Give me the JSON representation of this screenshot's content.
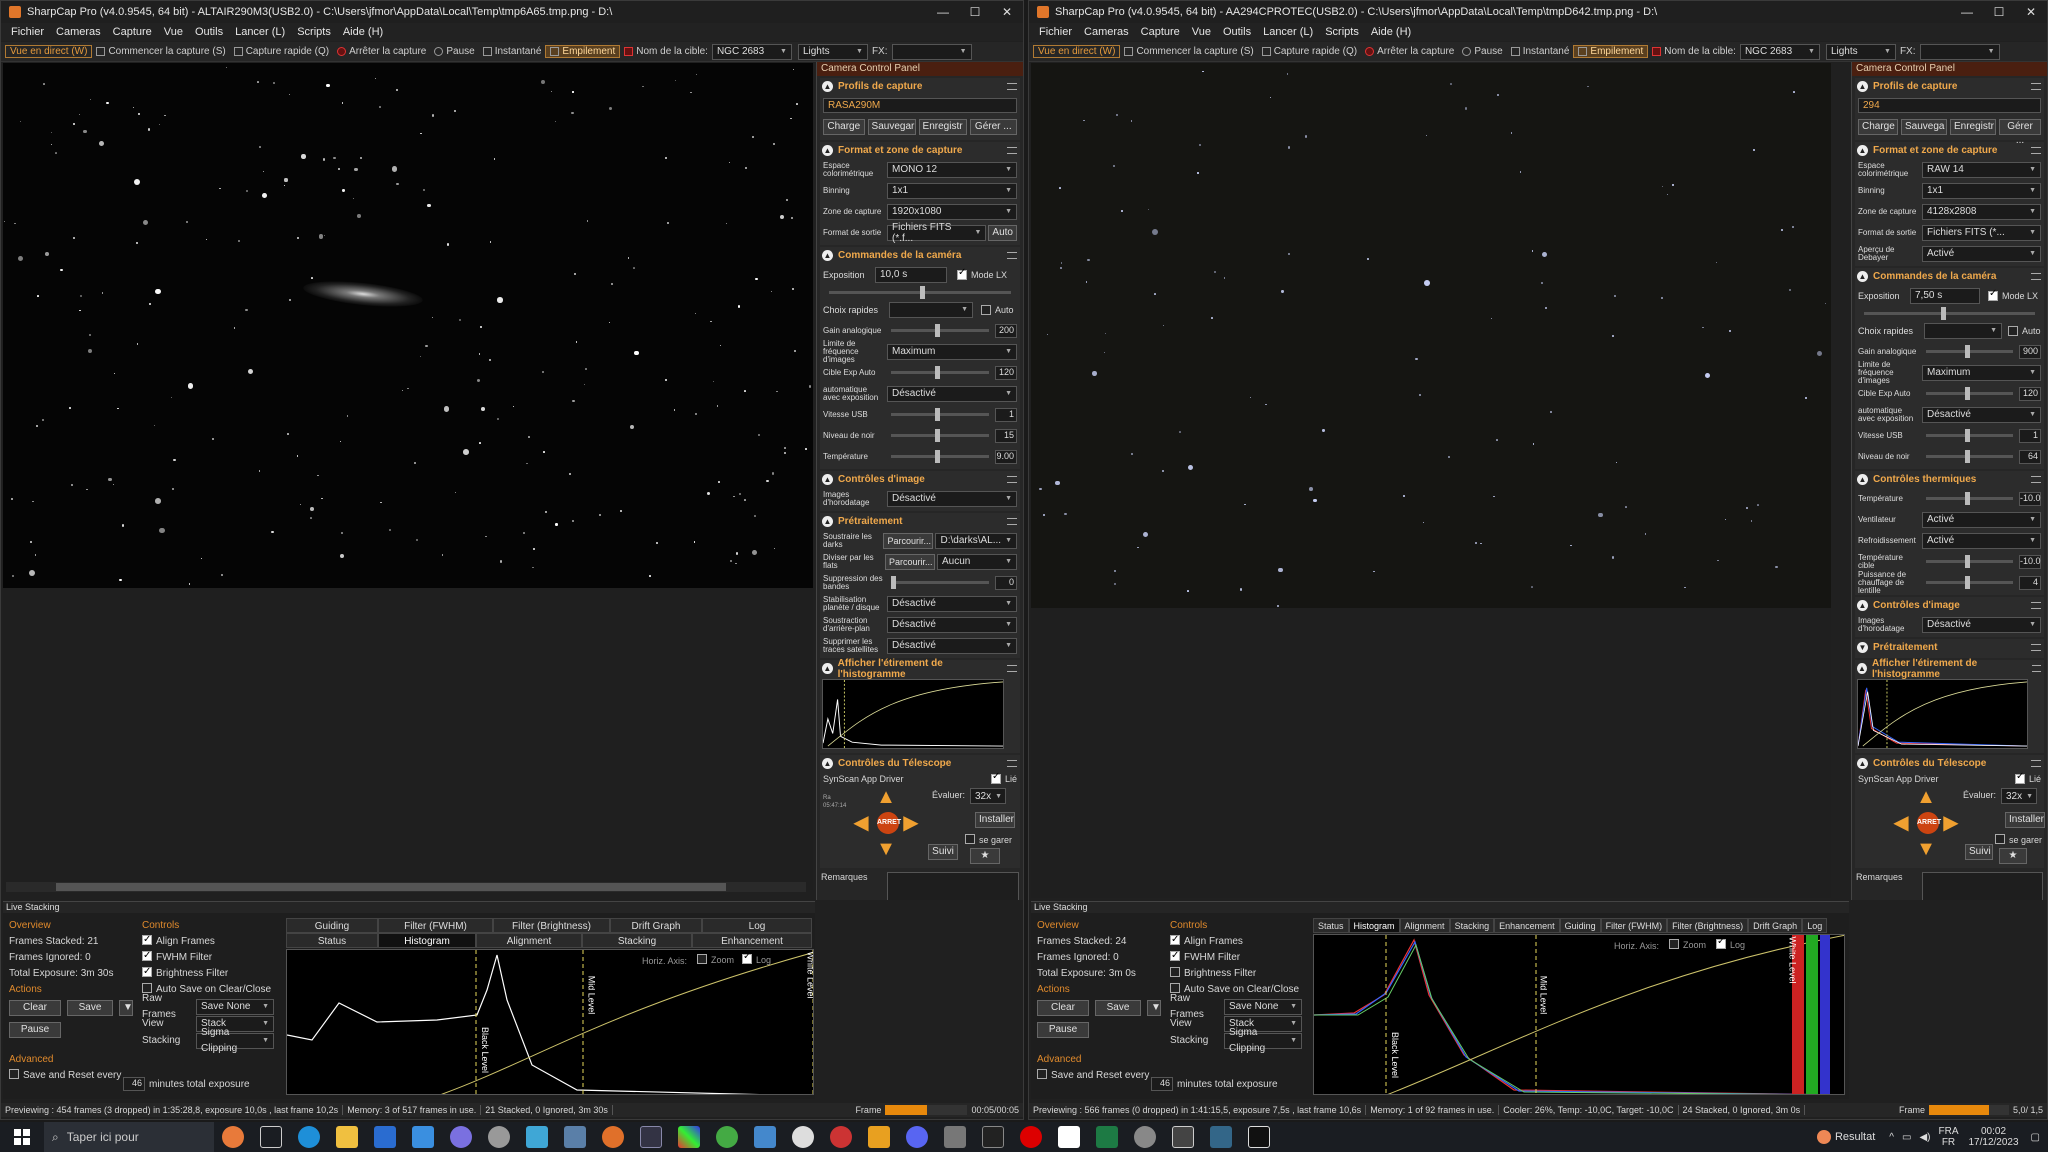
{
  "left": {
    "title": "SharpCap Pro (v4.0.9545, 64 bit) - ALTAIR290M3(USB2.0) - C:\\Users\\jfmor\\AppData\\Local\\Temp\\tmp6A65.tmp.png - D:\\",
    "menu": [
      "Fichier",
      "Cameras",
      "Capture",
      "Vue",
      "Outils",
      "Lancer (L)",
      "Scripts",
      "Aide (H)"
    ],
    "toolbar": {
      "live": "Vue en direct (W)",
      "start": "Commencer la capture (S)",
      "quick": "Capture rapide (Q)",
      "stop": "Arrêter la capture",
      "pause": "Pause",
      "snap": "Instantané",
      "stack": "Empilement",
      "target_label": "Nom de la cible:",
      "target": "NGC 2683",
      "frame_type": "Lights",
      "fx_label": "FX:"
    },
    "panel_title": "Camera Control Panel",
    "profiles": {
      "title": "Profils de capture",
      "value": "RASA290M",
      "buttons": [
        "Charge",
        "Sauvegar",
        "Enregistr",
        "Gérer ..."
      ]
    },
    "format": {
      "title": "Format et zone de capture",
      "rows": [
        {
          "label": "Espace colorimétrique",
          "value": "MONO 12"
        },
        {
          "label": "Binning",
          "value": "1x1"
        },
        {
          "label": "Zone de capture",
          "value": "1920x1080"
        },
        {
          "label": "Format de sortie",
          "value": "Fichiers FITS (*.f..."
        }
      ],
      "auto": "Auto"
    },
    "camera": {
      "title": "Commandes de la caméra",
      "exposure_label": "Exposition",
      "exposure": "10,0 s",
      "lx": "Mode LX",
      "quick_label": "Choix rapides",
      "auto": "Auto",
      "rows": [
        {
          "label": "Gain analogique",
          "value": "200",
          "kind": "slider"
        },
        {
          "label": "Limite de fréquence d'images",
          "value": "Maximum",
          "kind": "select"
        },
        {
          "label": "Cible Exp Auto",
          "value": "120",
          "kind": "slider"
        },
        {
          "label": "automatique avec exposition",
          "value": "Désactivé",
          "kind": "select"
        },
        {
          "label": "Vitesse USB",
          "value": "1",
          "kind": "slider"
        },
        {
          "label": "Niveau de noir",
          "value": "15",
          "kind": "slider"
        },
        {
          "label": "Température",
          "value": "9.00",
          "kind": "slider"
        }
      ]
    },
    "image_ctrl": {
      "title": "Contrôles d'image",
      "rows": [
        {
          "label": "Images d'horodatage",
          "value": "Désactivé"
        }
      ]
    },
    "preproc": {
      "title": "Prétraitement",
      "rows": [
        {
          "label": "Soustraire les darks",
          "browse": "Parcourir...",
          "value": "D:\\darks\\AL..."
        },
        {
          "label": "Diviser par les flats",
          "browse": "Parcourir...",
          "value": "Aucun"
        },
        {
          "label": "Suppression des bandes",
          "value": "0",
          "kind": "slider"
        },
        {
          "label": "Stabilisation planète / disque",
          "value": "Désactivé"
        },
        {
          "label": "Soustraction d'arrière-plan",
          "value": "Désactivé"
        },
        {
          "label": "Supprimer les traces satellites",
          "value": "Désactivé"
        }
      ]
    },
    "histo": {
      "title": "Afficher l'étirement de l'histogramme"
    },
    "telescope": {
      "title": "Contrôles du Télescope",
      "driver": "SynScan App Driver",
      "linked": "Lié",
      "eval_label": "Évaluer:",
      "eval": "32x",
      "install": "Installer",
      "park": "se garer",
      "suivi": "Suivi",
      "stop": "ARRET",
      "coords": "Ra 05:47:14"
    },
    "remarks": "Remarques",
    "livestack": {
      "title": "Live Stacking",
      "overview": "Overview",
      "stacked": "Frames Stacked: 21",
      "ignored": "Frames Ignored: 0",
      "exposure": "Total Exposure: 3m 30s",
      "actions": "Actions",
      "clear": "Clear",
      "save": "Save",
      "pause": "Pause",
      "advanced": "Advanced",
      "save_reset": "Save and Reset every",
      "minutes": "46",
      "minutes_label": "minutes total exposure",
      "controls": "Controls",
      "align": "Align Frames",
      "fwhm": "FWHM Filter",
      "bright": "Brightness Filter",
      "autosave": "Auto Save on Clear/Close",
      "raw_label": "Raw Frames",
      "raw": "Save None",
      "view_label": "View",
      "view": "Stack",
      "stacking_label": "Stacking",
      "stacking": "Sigma Clipping",
      "tabs_top": [
        "Guiding",
        "Filter (FWHM)",
        "Filter (Brightness)",
        "Drift Graph",
        "Log"
      ],
      "tabs_bottom": [
        "Status",
        "Histogram",
        "Alignment",
        "Stacking",
        "Enhancement"
      ],
      "horiz": "Horiz. Axis:",
      "zoom": "Zoom",
      "log": "Log",
      "black": "Black Level",
      "mid": "Mid Level",
      "white": "White Level"
    },
    "status": [
      "Previewing : 454 frames (3 dropped) in 1:35:28,8, exposure 10,0s , last frame 10,2s",
      "Memory: 3 of 517 frames in use.",
      "21 Stacked, 0 Ignored, 3m 30s"
    ],
    "frame_label": "Frame",
    "frame_time": "00:05/00:05"
  },
  "right": {
    "title": "SharpCap Pro (v4.0.9545, 64 bit) - AA294CPROTEC(USB2.0) - C:\\Users\\jfmor\\AppData\\Local\\Temp\\tmpD642.tmp.png - D:\\",
    "toolbar": {
      "target": "NGC 2683",
      "frame_type": "Lights"
    },
    "profiles": {
      "value": "294",
      "buttons": [
        "Charge",
        "Sauvega",
        "Enregistr",
        "Gérer ..."
      ]
    },
    "format": {
      "rows": [
        {
          "label": "Espace colorimétrique",
          "value": "RAW 14"
        },
        {
          "label": "Binning",
          "value": "1x1"
        },
        {
          "label": "Zone de capture",
          "value": "4128x2808"
        },
        {
          "label": "Format de sortie",
          "value": "Fichiers FITS (*..."
        },
        {
          "label": "Aperçu de Debayer",
          "value": "Activé"
        }
      ]
    },
    "camera": {
      "exposure": "7,50 s",
      "rows": [
        {
          "label": "Gain analogique",
          "value": "900",
          "kind": "slider"
        },
        {
          "label": "Limite de fréquence d'images",
          "value": "Maximum",
          "kind": "select"
        },
        {
          "label": "Cible Exp Auto",
          "value": "120",
          "kind": "slider"
        },
        {
          "label": "automatique avec exposition",
          "value": "Désactivé",
          "kind": "select"
        },
        {
          "label": "Vitesse USB",
          "value": "1",
          "kind": "slider"
        },
        {
          "label": "Niveau de noir",
          "value": "64",
          "kind": "slider"
        }
      ]
    },
    "thermal": {
      "title": "Contrôles thermiques",
      "rows": [
        {
          "label": "Température",
          "value": "-10.0",
          "kind": "slider"
        },
        {
          "label": "Ventilateur",
          "value": "Activé",
          "kind": "select"
        },
        {
          "label": "Refroidissement",
          "value": "Activé",
          "kind": "select"
        },
        {
          "label": "Température cible",
          "value": "-10.0",
          "kind": "slider"
        },
        {
          "label": "Puissance de chauffage de lentille",
          "value": "4",
          "kind": "slider"
        }
      ]
    },
    "image_ctrl": {
      "rows": [
        {
          "label": "Images d'horodatage",
          "value": "Désactivé"
        }
      ]
    },
    "livestack": {
      "stacked": "Frames Stacked: 24",
      "ignored": "Frames Ignored: 0",
      "exposure": "Total Exposure: 3m 0s",
      "tabs": [
        "Status",
        "Histogram",
        "Alignment",
        "Stacking",
        "Enhancement",
        "Guiding",
        "Filter (FWHM)",
        "Filter (Brightness)",
        "Drift Graph",
        "Log"
      ]
    },
    "status": [
      "Previewing : 566 frames (0 dropped) in 1:41:15,5, exposure 7,5s , last frame 10,6s",
      "Memory: 1 of 92 frames in use.",
      "Cooler: 26%, Temp: -10,0C, Target: -10,0C",
      "24 Stacked, 0 Ignored, 3m 0s"
    ],
    "frame_time": "5,0/ 1,5"
  },
  "taskbar": {
    "search": "Taper ici pour",
    "weather": "Resultat",
    "lang1": "FRA",
    "lang2": "FR",
    "time": "00:02",
    "date": "17/12/2023"
  }
}
